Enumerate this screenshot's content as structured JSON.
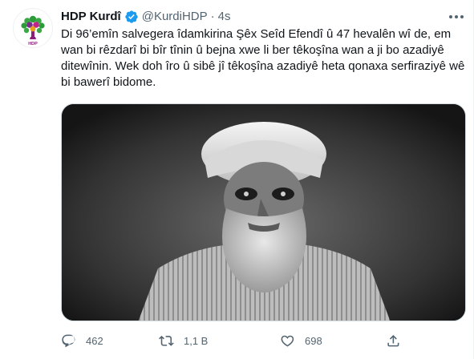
{
  "tweet": {
    "author_name": "HDP Kurdî",
    "handle": "@KurdiHDP",
    "separator": "·",
    "time": "4s",
    "text": "Di 96’emîn salvegera îdamkirina Şêx Seîd Efendî û 47 hevalên wî de, em wan bi rêzdarî bi bîr tînin û bejna xwe li ber têkoşîna wan a ji bo azadiyê ditewînin. Wek doh îro û sibê jî têkoşîna azadiyê heta qonaxa serfiraziyê wê bi bawerî bidome.",
    "avatar_text": "HDP"
  },
  "actions": {
    "replies": "462",
    "retweets": "1,1 B",
    "likes": "698"
  },
  "icons": {
    "verified": "verified-badge-icon",
    "more": "more-dots-icon",
    "reply": "reply-icon",
    "retweet": "retweet-icon",
    "like": "heart-icon",
    "share": "share-icon"
  },
  "colors": {
    "verified_blue": "#1d9bf0",
    "muted": "#536471",
    "logo_green": "#2e9b3a",
    "logo_purple": "#8b1f7a"
  }
}
